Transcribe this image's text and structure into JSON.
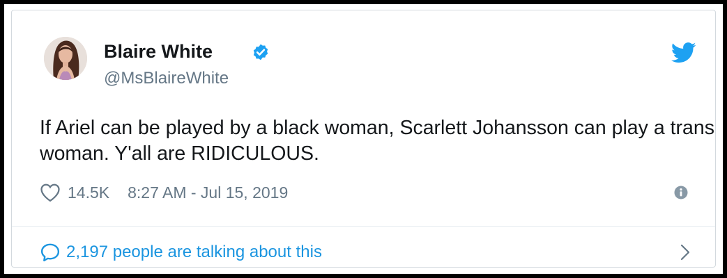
{
  "author": {
    "name": "Blaire White",
    "handle": "@MsBlaireWhite",
    "verified": true,
    "avatar_icon": "profile-photo"
  },
  "tweet": {
    "text": "If Ariel can be played by a black woman, Scarlett Johansson can play a trans woman. Y'all are RIDICULOUS.",
    "likes": "14.5K",
    "timestamp": "8:27 AM - Jul 15, 2019"
  },
  "footer": {
    "talking_text": "2,197 people are talking about this"
  },
  "icons": {
    "brand": "twitter-bird-icon",
    "verified": "verified-badge-icon",
    "like": "heart-icon",
    "info": "info-icon",
    "reply": "speech-bubble-icon",
    "more": "chevron-right-icon"
  },
  "colors": {
    "twitter_blue": "#1da1f2",
    "link_blue": "#1b95e0",
    "text_dark": "#14171a",
    "text_gray": "#657786",
    "frame": "#000000"
  }
}
